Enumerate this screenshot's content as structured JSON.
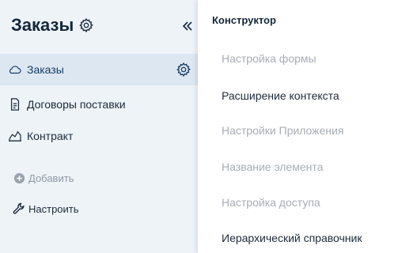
{
  "sidebar": {
    "title": "Заказы",
    "collapse_icon": "double-chevron-left",
    "items": [
      {
        "label": "Заказы",
        "icon": "cloud-icon",
        "active": true
      },
      {
        "label": "Договоры поставки",
        "icon": "document-icon",
        "active": false
      },
      {
        "label": "Контракт",
        "icon": "chart-icon",
        "active": false
      }
    ],
    "actions": [
      {
        "label": "Добавить",
        "icon": "add-circle-icon",
        "disabled": true
      },
      {
        "label": "Настроить",
        "icon": "wrench-icon",
        "disabled": false
      }
    ]
  },
  "dropdown": {
    "header": "Конструктор",
    "items": [
      {
        "label": "Настройка формы",
        "disabled": true
      },
      {
        "label": "Расширение контекста",
        "disabled": false
      },
      {
        "label": "Настройки Приложения",
        "disabled": true
      },
      {
        "label": "Название элемента",
        "disabled": true
      },
      {
        "label": "Настройка доступа",
        "disabled": true
      },
      {
        "label": "Иерархический справочник",
        "disabled": false
      }
    ]
  },
  "colors": {
    "sidebar_bg": "#eef3f8",
    "active_bg": "#dde7f2",
    "text": "#1d2a3a",
    "muted": "#a7adb4",
    "accent": "#163d66"
  }
}
